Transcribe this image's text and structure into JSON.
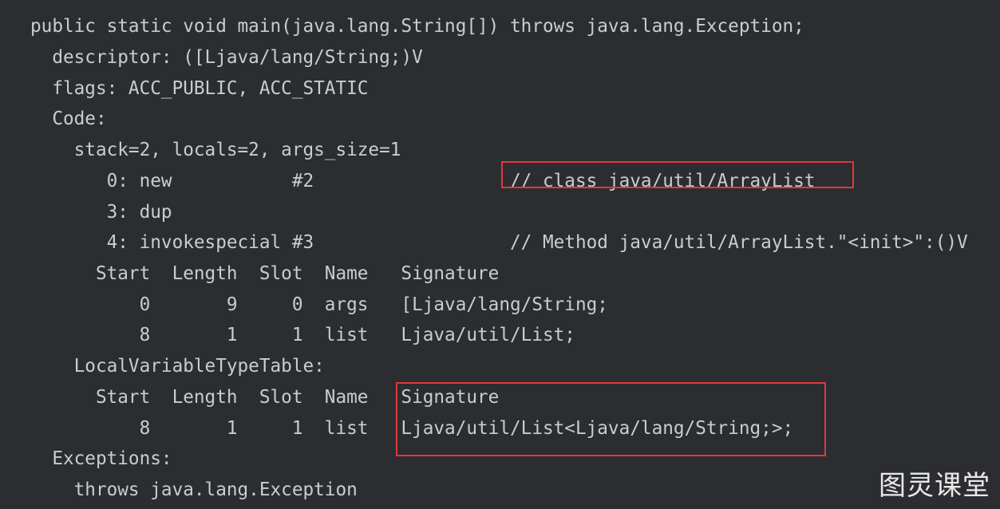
{
  "lines": [
    "public static void main(java.lang.String[]) throws java.lang.Exception;",
    "  descriptor: ([Ljava/lang/String;)V",
    "  flags: ACC_PUBLIC, ACC_STATIC",
    "  Code:",
    "    stack=2, locals=2, args_size=1",
    "       0: new           #2                  // class java/util/ArrayList",
    "       3: dup",
    "       4: invokespecial #3                  // Method java/util/ArrayList.\"<init>\":()V",
    "      Start  Length  Slot  Name   Signature",
    "          0       9     0  args   [Ljava/lang/String;",
    "          8       1     1  list   Ljava/util/List;",
    "    LocalVariableTypeTable:",
    "      Start  Length  Slot  Name   Signature",
    "          8       1     1  list   Ljava/util/List<Ljava/lang/String;>;",
    "  Exceptions:",
    "    throws java.lang.Exception"
  ],
  "watermark": "图灵课堂",
  "colors": {
    "background": "#2b2d30",
    "text": "#c9ccd1",
    "highlight_box": "#e0393b"
  }
}
